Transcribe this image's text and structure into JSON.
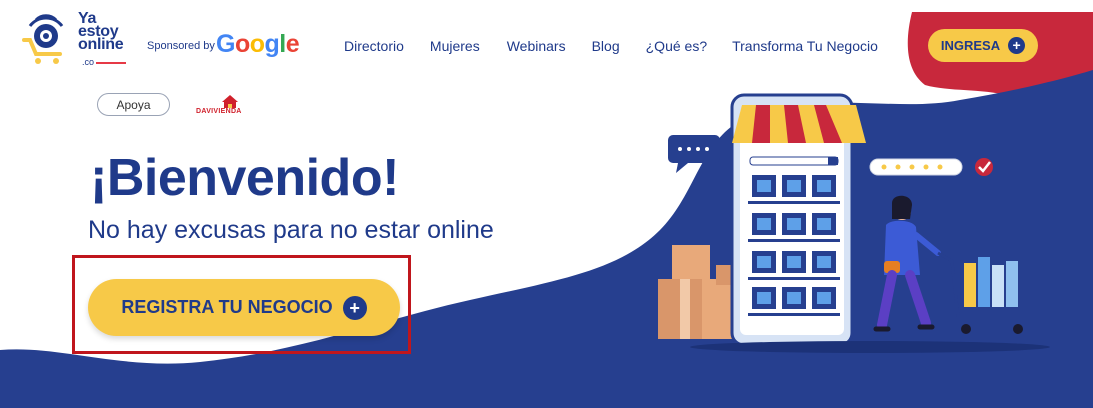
{
  "brand": {
    "logo_lines": [
      "Ya",
      "estoy",
      "online"
    ],
    "logo_suffix": ".co",
    "sponsored_by": "Sponsored by",
    "google": [
      "G",
      "o",
      "o",
      "g",
      "l",
      "e"
    ]
  },
  "nav": {
    "items": [
      "Directorio",
      "Mujeres",
      "Webinars",
      "Blog",
      "¿Qué es?",
      "Transforma Tu Negocio"
    ]
  },
  "header": {
    "ingresa_label": "INGRESA"
  },
  "support": {
    "apoya_label": "Apoya",
    "partner": "DAVIVIENDA"
  },
  "hero": {
    "title": "¡Bienvenido!",
    "subtitle": "No hay excusas para no estar online",
    "cta_label": "REGISTRA TU NEGOCIO"
  },
  "colors": {
    "navy": "#1f3a8a",
    "yellow": "#f7c948",
    "red": "#c8283c",
    "highlight": "#c0161c"
  }
}
